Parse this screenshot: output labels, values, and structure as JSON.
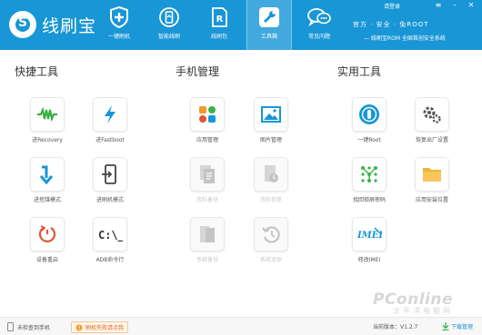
{
  "app": {
    "name": "线刷宝",
    "login": "请登录",
    "slogan1": "官方 · 安全 · 免ROOT",
    "slogan2": "线刷宝ROM 全国首创安全系统"
  },
  "colors": {
    "brand": "#1896d6",
    "header_bg": "#1896d6"
  },
  "nav": [
    {
      "label": "一键刷机",
      "icon": "plus-shield-icon"
    },
    {
      "label": "智能线刷",
      "icon": "phone-refresh-icon"
    },
    {
      "label": "线刷包",
      "icon": "rom-package-icon"
    },
    {
      "label": "工具箱",
      "icon": "wrench-icon",
      "active": true
    },
    {
      "label": "常见问题",
      "icon": "chat-bubbles-icon"
    }
  ],
  "sections": {
    "quick": {
      "title": "快捷工具",
      "tools": [
        {
          "label": "进Recovery",
          "icon": "recovery-wave-icon"
        },
        {
          "label": "进Fastboot",
          "icon": "lightning-icon"
        },
        {
          "label": "进挖煤模式",
          "icon": "down-arrow-icon"
        },
        {
          "label": "进刷机模式",
          "icon": "phone-enter-icon"
        },
        {
          "label": "设备重启",
          "icon": "restart-icon"
        },
        {
          "label": "ADB命令行",
          "icon": "terminal-icon"
        }
      ]
    },
    "phone": {
      "title": "手机管理",
      "tools": [
        {
          "label": "应用管理",
          "icon": "apps-grid-icon"
        },
        {
          "label": "图片管理",
          "icon": "picture-icon"
        },
        {
          "label": "资料备份",
          "icon": "document-backup-icon",
          "disabled": true
        },
        {
          "label": "资料恢复",
          "icon": "document-restore-icon",
          "disabled": true
        },
        {
          "label": "系统备份",
          "icon": "system-backup-icon",
          "disabled": true
        },
        {
          "label": "系统还原",
          "icon": "system-restore-icon",
          "disabled": true
        }
      ]
    },
    "util": {
      "title": "实用工具",
      "tools": [
        {
          "label": "一键Root",
          "icon": "root-lock-icon"
        },
        {
          "label": "恢复出厂设置",
          "icon": "gear-icon"
        },
        {
          "label": "找回锁屏密码",
          "icon": "pattern-lock-icon"
        },
        {
          "label": "应用安装位置",
          "icon": "folder-icon"
        },
        {
          "label": "修改IMEI",
          "icon": "imei-icon"
        }
      ]
    }
  },
  "footer": {
    "status": "未检查到手机",
    "help": "刷机失败请点我",
    "version": "当前版本：V1.2.7",
    "download": "下载管理"
  },
  "watermark": {
    "main": "PConline",
    "sub": "太平洋电脑网"
  }
}
